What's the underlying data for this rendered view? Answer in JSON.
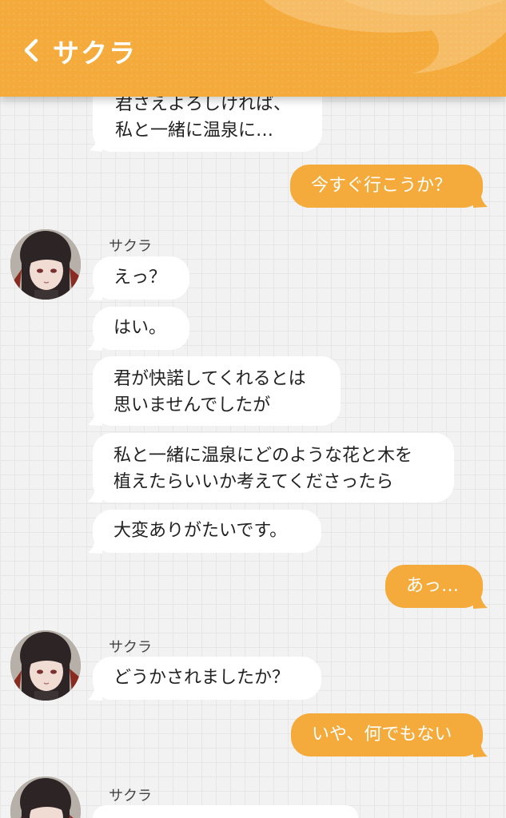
{
  "header": {
    "title": "サクラ",
    "back_icon": "chevron-left-icon",
    "color": "#f4ab3b"
  },
  "messages": [
    {
      "from": "in",
      "text_lines": [
        "君さえよろしければ、",
        "私と一緒に温泉に…"
      ]
    },
    {
      "from": "out",
      "text": "今すぐ行こうか？"
    },
    {
      "from": "in",
      "sender": "サクラ",
      "text": "えっ？"
    },
    {
      "from": "in",
      "text": "はい。"
    },
    {
      "from": "in",
      "text_lines": [
        "君が快諾してくれるとは",
        "思いませんでしたが"
      ]
    },
    {
      "from": "in",
      "text_lines": [
        "私と一緒に温泉にどのような花と木を",
        "植えたらいいか考えてくださったら"
      ]
    },
    {
      "from": "in",
      "text": "大変ありがたいです。"
    },
    {
      "from": "out",
      "text": "あっ…"
    },
    {
      "from": "in",
      "sender": "サクラ",
      "text": "どうかされましたか？"
    },
    {
      "from": "out",
      "text": "いや、何でもない"
    },
    {
      "from": "in",
      "sender": "サクラ",
      "text": ""
    }
  ],
  "colors": {
    "accent": "#f4ab3b",
    "incoming_bubble": "#ffffff",
    "outgoing_text": "#ffffff",
    "background": "#f2f2f2"
  }
}
